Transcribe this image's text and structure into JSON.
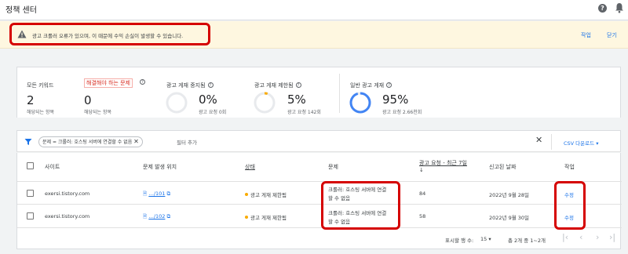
{
  "header": {
    "title": "정책 센터",
    "help_icon": "help-icon",
    "bell_icon": "notifications-icon"
  },
  "banner": {
    "message": "광고 크롤러 오류가 있으며, 이 때문에 수익 손실이 발생할 수 있습니다.",
    "action_label": "작업",
    "close_label": "닫기",
    "icon": "warning-icon"
  },
  "summary": {
    "all_keywords": {
      "label": "모든 키워드",
      "value": "2",
      "sub": "해당되는 항목"
    },
    "must_fix": {
      "label": "해결해야 하는 문제",
      "value": "0",
      "sub": "해당되는 항목"
    },
    "serving_stopped": {
      "label": "광고 게재 중지됨",
      "value": "0%",
      "sub": "광고 요청 0회",
      "fraction": 0
    },
    "serving_limited": {
      "label": "광고 게재 제한됨",
      "value": "5%",
      "sub": "광고 요청 142회",
      "fraction": 0.05
    },
    "serving_normal": {
      "label": "일반 광고 게재",
      "value": "95%",
      "sub": "광고 요청 2.66천회",
      "fraction": 0.95
    }
  },
  "filter": {
    "chip_label": "문제 = 크롤러: 호스팅 서버에 연결할 수 없음",
    "add_filter": "필터 추가",
    "csv_label": "CSV 다운로드"
  },
  "table": {
    "columns": {
      "site": "사이트",
      "location": "문제 발생 위치",
      "status": "상태",
      "issue": "문제",
      "requests": "광고 요청 - 최근 7일",
      "reported": "신고된 날짜",
      "action": "작업"
    },
    "rows": [
      {
        "site": "exersi.tistory.com",
        "location": "…/101",
        "status": "광고 게재 제한됨",
        "issue_line1": "크롤러: 호스팅 서버에 연결",
        "issue_line2": "할 수 없음",
        "requests": "84",
        "reported": "2022년 9월 28일",
        "action": "수정"
      },
      {
        "site": "exersi.tistory.com",
        "location": "…/102",
        "status": "광고 게재 제한됨",
        "issue_line1": "크롤러: 호스팅 서버에 연결",
        "issue_line2": "할 수 없음",
        "requests": "58",
        "reported": "2022년 9월 30일",
        "action": "수정"
      }
    ]
  },
  "pagination": {
    "rows_label": "표시할 행 수:",
    "rows_value": "15",
    "range": "총 2개 중 1~2개"
  },
  "colors": {
    "accent": "#1a73e8",
    "warning_bg": "#fef7e0",
    "highlight": "#d50000",
    "limited_dot": "#f9ab00"
  }
}
